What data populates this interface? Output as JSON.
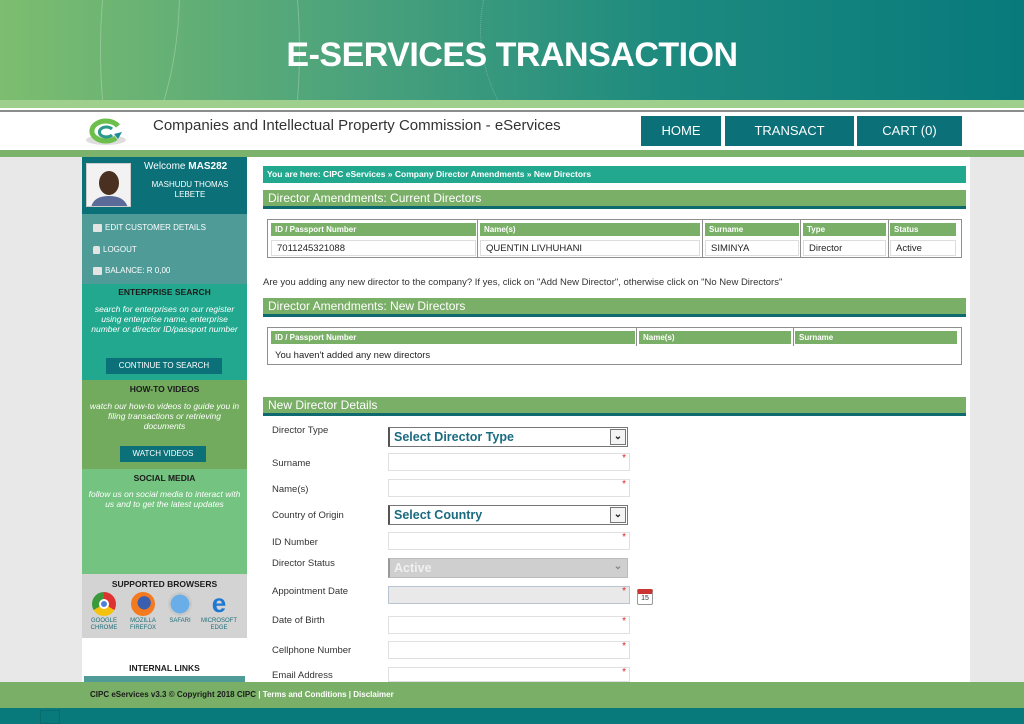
{
  "banner": {
    "title": "E-SERVICES TRANSACTION"
  },
  "header": {
    "site_name": "Companies and Intellectual Property Commission - eServices",
    "nav": [
      {
        "label": "HOME"
      },
      {
        "label": "TRANSACT"
      },
      {
        "label": "CART (0)"
      }
    ]
  },
  "sidebar": {
    "welcome_prefix": "Welcome",
    "username": "MAS282",
    "full_name": "MASHUDU THOMAS LEBETE",
    "links": [
      {
        "label": "EDIT CUSTOMER DETAILS",
        "icon": "edit-icon"
      },
      {
        "label": "LOGOUT",
        "icon": "lock-icon"
      },
      {
        "label": "BALANCE: R 0,00",
        "icon": "wallet-icon"
      }
    ],
    "enterprise_search": {
      "title": "ENTERPRISE SEARCH",
      "text": "search for enterprises on our register using enterprise name, enterprise number or director ID/passport number",
      "button": "CONTINUE TO SEARCH"
    },
    "how_to": {
      "title": "HOW-TO VIDEOS",
      "text": "watch our how-to videos to guide you in filing transactions or retrieving documents",
      "button": "WATCH VIDEOS"
    },
    "social": {
      "title": "SOCIAL MEDIA",
      "text": "follow us on social media to interact with us and to get the latest updates"
    },
    "browsers": {
      "title": "SUPPORTED BROWSERS",
      "items": [
        {
          "line1": "GOOGLE",
          "line2": "CHROME"
        },
        {
          "line1": "MOZILLA",
          "line2": "FIREFOX"
        },
        {
          "line1": "SAFARI",
          "line2": ""
        },
        {
          "line1": "MICROSOFT",
          "line2": "EDGE"
        }
      ]
    },
    "internal_links": {
      "title": "INTERNAL LINKS"
    }
  },
  "main": {
    "breadcrumb": "You are here: CIPC eServices » Company Director Amendments » New Directors",
    "current_directors": {
      "title": "Director Amendments: Current Directors",
      "columns": [
        "ID / Passport Number",
        "Name(s)",
        "Surname",
        "Type",
        "Status"
      ],
      "rows": [
        [
          "7011245321088",
          "QUENTIN LIVHUHANI",
          "SIMINYA",
          "Director",
          "Active"
        ]
      ]
    },
    "question": "Are you adding any new director to the company? If yes, click on \"Add New Director\", otherwise click on \"No New Directors\"",
    "new_directors": {
      "title": "Director Amendments: New Directors",
      "columns": [
        "ID / Passport Number",
        "Name(s)",
        "Surname"
      ],
      "empty_message": "You haven't added any new directors"
    },
    "form": {
      "title": "New Director Details",
      "director_type": {
        "label": "Director Type",
        "value": "Select Director Type"
      },
      "surname": {
        "label": "Surname",
        "value": ""
      },
      "names": {
        "label": "Name(s)",
        "value": ""
      },
      "country": {
        "label": "Country of Origin",
        "value": "Select Country"
      },
      "id_number": {
        "label": "ID Number",
        "value": ""
      },
      "status": {
        "label": "Director Status",
        "value": "Active"
      },
      "appointment_date": {
        "label": "Appointment Date",
        "value": ""
      },
      "dob": {
        "label": "Date of Birth",
        "value": ""
      },
      "cellphone": {
        "label": "Cellphone Number",
        "value": ""
      },
      "email": {
        "label": "Email Address",
        "value": ""
      },
      "required_marker": "*",
      "calendar_day": "15"
    }
  },
  "footer": {
    "copyright": "CIPC eServices v3.3 © Copyright 2018 CIPC",
    "separator": "|",
    "terms": "Terms and Conditions",
    "disclaimer": "Disclaimer"
  }
}
